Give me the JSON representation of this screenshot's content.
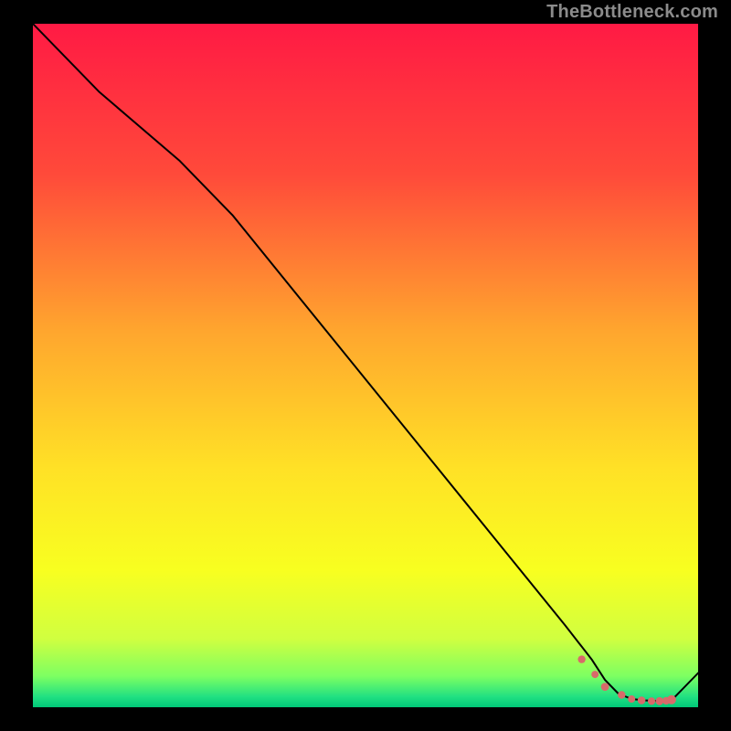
{
  "watermark": "TheBottleneck.com",
  "chart_data": {
    "type": "line",
    "title": "",
    "xlabel": "",
    "ylabel": "",
    "xlim": [
      0,
      100
    ],
    "ylim": [
      0,
      100
    ],
    "grid": false,
    "legend_position": "none",
    "gradient_stops": [
      {
        "offset": 0.0,
        "color": "#ff1a44"
      },
      {
        "offset": 0.22,
        "color": "#ff4a3a"
      },
      {
        "offset": 0.45,
        "color": "#ffa62e"
      },
      {
        "offset": 0.65,
        "color": "#ffe126"
      },
      {
        "offset": 0.8,
        "color": "#f8ff20"
      },
      {
        "offset": 0.9,
        "color": "#d0ff40"
      },
      {
        "offset": 0.955,
        "color": "#7cff62"
      },
      {
        "offset": 0.985,
        "color": "#20e082"
      },
      {
        "offset": 1.0,
        "color": "#00c878"
      }
    ],
    "series": [
      {
        "name": "curve",
        "x": [
          0,
          10,
          22,
          30,
          40,
          50,
          60,
          70,
          80,
          84,
          86,
          88,
          90,
          92,
          94,
          96,
          100
        ],
        "y": [
          100,
          90,
          80,
          72,
          60,
          48,
          36,
          24,
          12,
          7,
          4,
          2,
          1.2,
          1,
          0.9,
          1,
          5
        ]
      }
    ],
    "markers": {
      "name": "dots",
      "color": "#d86a6a",
      "x": [
        82.5,
        84.5,
        86.0,
        88.5,
        90.0,
        91.5,
        93.0,
        94.2,
        95.2,
        96.0
      ],
      "y": [
        7.0,
        4.8,
        3.0,
        1.8,
        1.2,
        1.0,
        0.9,
        0.9,
        0.95,
        1.1
      ],
      "r": [
        4.2,
        4.0,
        4.4,
        4.2,
        4.0,
        4.3,
        4.1,
        4.4,
        4.2,
        5.0
      ]
    }
  }
}
